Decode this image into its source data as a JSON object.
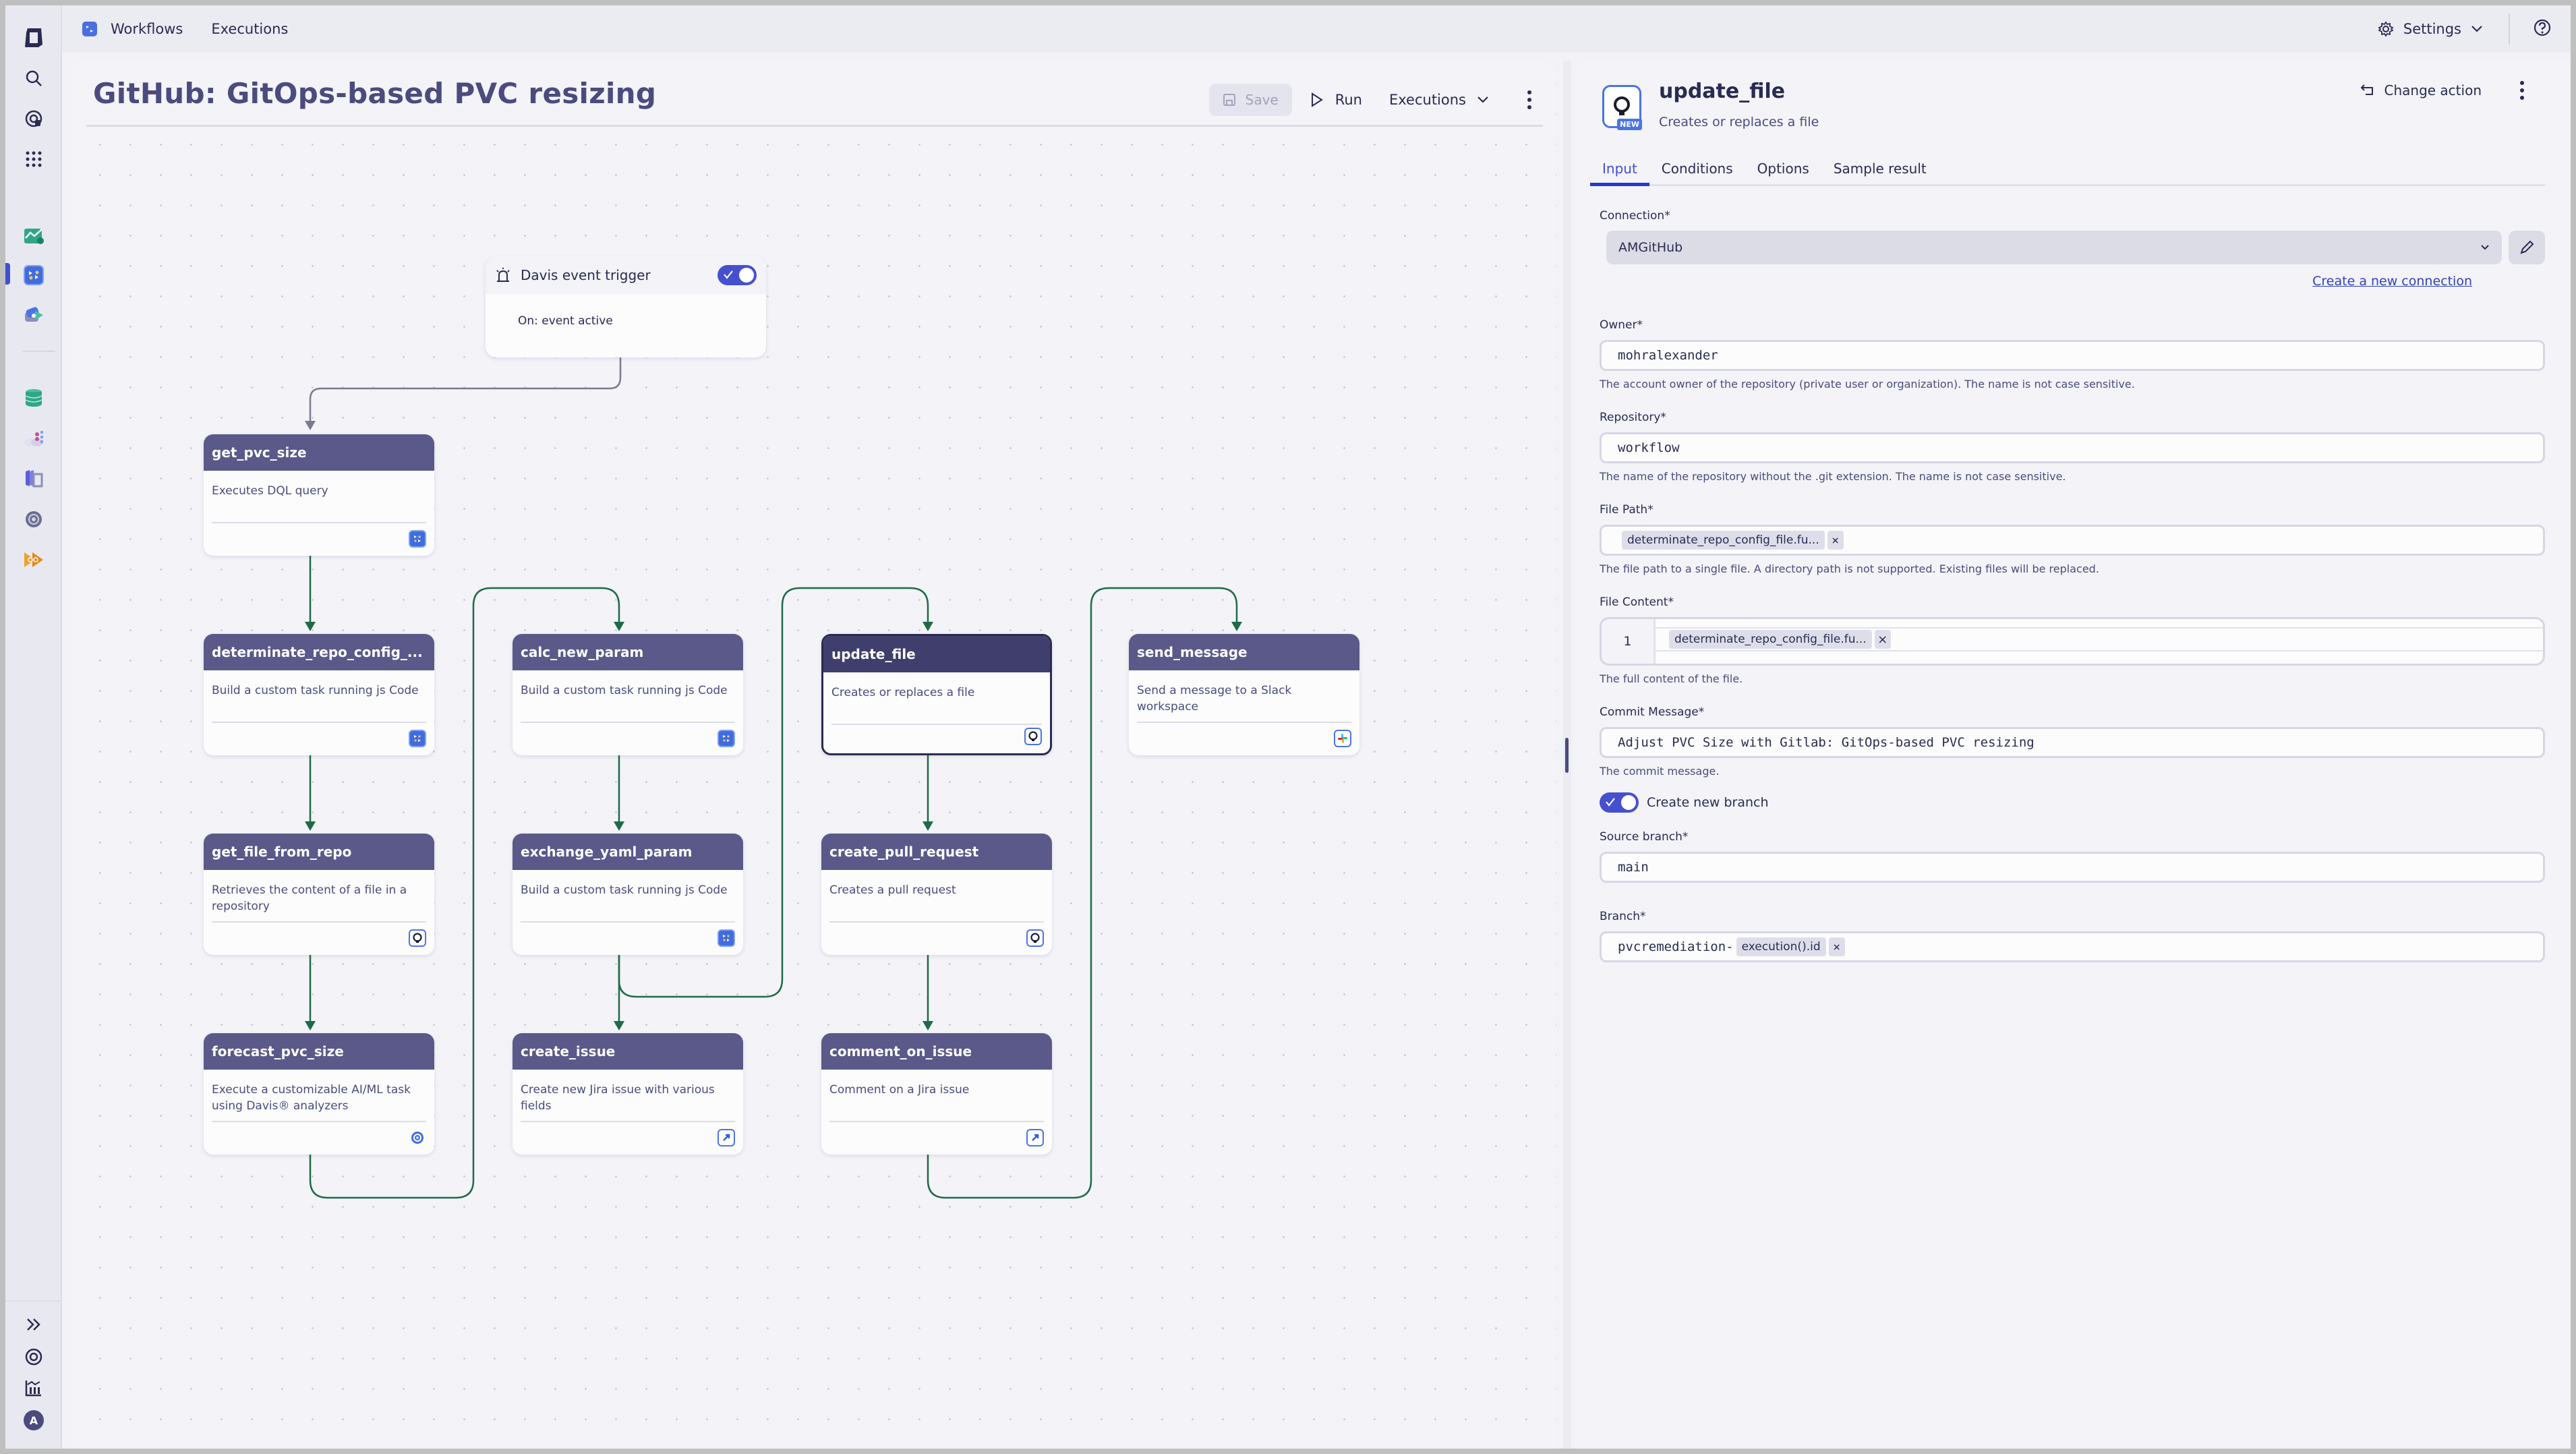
{
  "topbar": {
    "crumbs": [
      "Workflows",
      "Executions"
    ],
    "settings_label": "Settings"
  },
  "rail": {
    "top_icons": [
      "dynatrace-logo-icon",
      "search-icon",
      "ai-assistant-icon",
      "apps-grid-icon"
    ],
    "app_icons": [
      "dashboards-app-icon",
      "workflows-app-icon",
      "notebooks-app-icon",
      "database-app-icon",
      "cloud-app-icon",
      "kubernetes-app-icon",
      "settings-app-icon",
      "davis-app-icon"
    ],
    "bottom_icons": [
      "expand-icon",
      "support-icon",
      "usage-icon"
    ],
    "avatar_initial": "A"
  },
  "canvas": {
    "title": "GitHub: GitOps-based PVC resizing",
    "save_label": "Save",
    "run_label": "Run",
    "executions_label": "Executions",
    "trigger": {
      "title": "Davis event trigger",
      "enabled": true,
      "body": "On: event active"
    },
    "nodes": [
      {
        "name": "get_pvc_size",
        "desc": "Executes DQL query",
        "icon": "workflow-icon"
      },
      {
        "name": "determinate_repo_config_...",
        "desc": "Build a custom task running js Code",
        "icon": "workflow-icon"
      },
      {
        "name": "get_file_from_repo",
        "desc": "Retrieves the content of a file in a repository",
        "icon": "github-icon"
      },
      {
        "name": "forecast_pvc_size",
        "desc": "Execute a customizable AI/ML task using Davis® analyzers",
        "icon": "davis-icon"
      },
      {
        "name": "calc_new_param",
        "desc": "Build a custom task running js Code",
        "icon": "workflow-icon"
      },
      {
        "name": "exchange_yaml_param",
        "desc": "Build a custom task running js Code",
        "icon": "workflow-icon"
      },
      {
        "name": "create_issue",
        "desc": "Create new Jira issue with various fields",
        "icon": "jira-icon"
      },
      {
        "name": "update_file",
        "desc": "Creates or replaces a file",
        "icon": "github-icon",
        "selected": true
      },
      {
        "name": "create_pull_request",
        "desc": "Creates a pull request",
        "icon": "github-icon"
      },
      {
        "name": "comment_on_issue",
        "desc": "Comment on a Jira issue",
        "icon": "jira-icon"
      },
      {
        "name": "send_message",
        "desc": "Send a message to a Slack workspace",
        "icon": "slack-icon"
      }
    ]
  },
  "panel": {
    "title": "update_file",
    "subtitle": "Creates or replaces a file",
    "badge": "NEW",
    "change_action_label": "Change action",
    "tabs": [
      "Input",
      "Conditions",
      "Options",
      "Sample result"
    ],
    "active_tab": "Input",
    "connection": {
      "label": "Connection*",
      "value": "AMGitHub",
      "create_link": "Create a new connection"
    },
    "owner": {
      "label": "Owner*",
      "value": "mohralexander",
      "hint": "The account owner of the repository (private user or organization). The name is not case sensitive."
    },
    "repository": {
      "label": "Repository*",
      "value": "workflow",
      "hint": "The name of the repository without the .git extension. The name is not case sensitive."
    },
    "file_path": {
      "label": "File Path*",
      "chip": "determinate_repo_config_file.fu...",
      "hint": "The file path to a single file. A directory path is not supported. Existing files will be replaced."
    },
    "file_content": {
      "label": "File Content*",
      "line_number": "1",
      "chip": "determinate_repo_config_file.fu...",
      "hint": "The full content of the file."
    },
    "commit_message": {
      "label": "Commit Message*",
      "value": "Adjust PVC Size with Gitlab: GitOps-based PVC resizing",
      "hint": "The commit message."
    },
    "create_branch": {
      "label": "Create new branch",
      "enabled": true
    },
    "source_branch": {
      "label": "Source branch*",
      "value": "main"
    },
    "branch": {
      "label": "Branch*",
      "prefix": "pvcremediation-",
      "chip": "execution().id"
    }
  }
}
